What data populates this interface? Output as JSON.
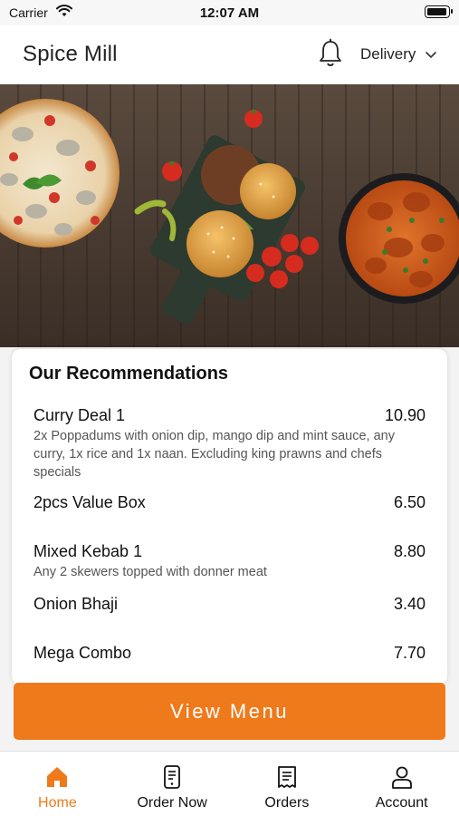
{
  "status_bar": {
    "carrier": "Carrier",
    "time": "12:07 AM"
  },
  "header": {
    "title": "Spice Mill",
    "delivery_label": "Delivery"
  },
  "recommendations": {
    "title": "Our Recommendations",
    "items": [
      {
        "name": "Curry Deal 1",
        "price": "10.90",
        "description": "2x Poppadums with onion dip, mango dip and mint sauce, any curry, 1x rice and 1x naan. Excluding king prawns and chefs specials"
      },
      {
        "name": "2pcs Value Box",
        "price": "6.50",
        "description": ""
      },
      {
        "name": "Mixed Kebab 1",
        "price": "8.80",
        "description": "Any 2 skewers topped with donner meat"
      },
      {
        "name": "Onion Bhaji",
        "price": "3.40",
        "description": ""
      },
      {
        "name": "Mega Combo",
        "price": "7.70",
        "description": ""
      }
    ]
  },
  "view_menu_label": "View Menu",
  "tabs": [
    {
      "label": "Home",
      "icon": "home-icon",
      "active": true
    },
    {
      "label": "Order Now",
      "icon": "order-icon",
      "active": false
    },
    {
      "label": "Orders",
      "icon": "receipt-icon",
      "active": false
    },
    {
      "label": "Account",
      "icon": "user-icon",
      "active": false
    }
  ],
  "colors": {
    "accent": "#ee7a1c",
    "text": "#111111",
    "muted": "#555555"
  }
}
